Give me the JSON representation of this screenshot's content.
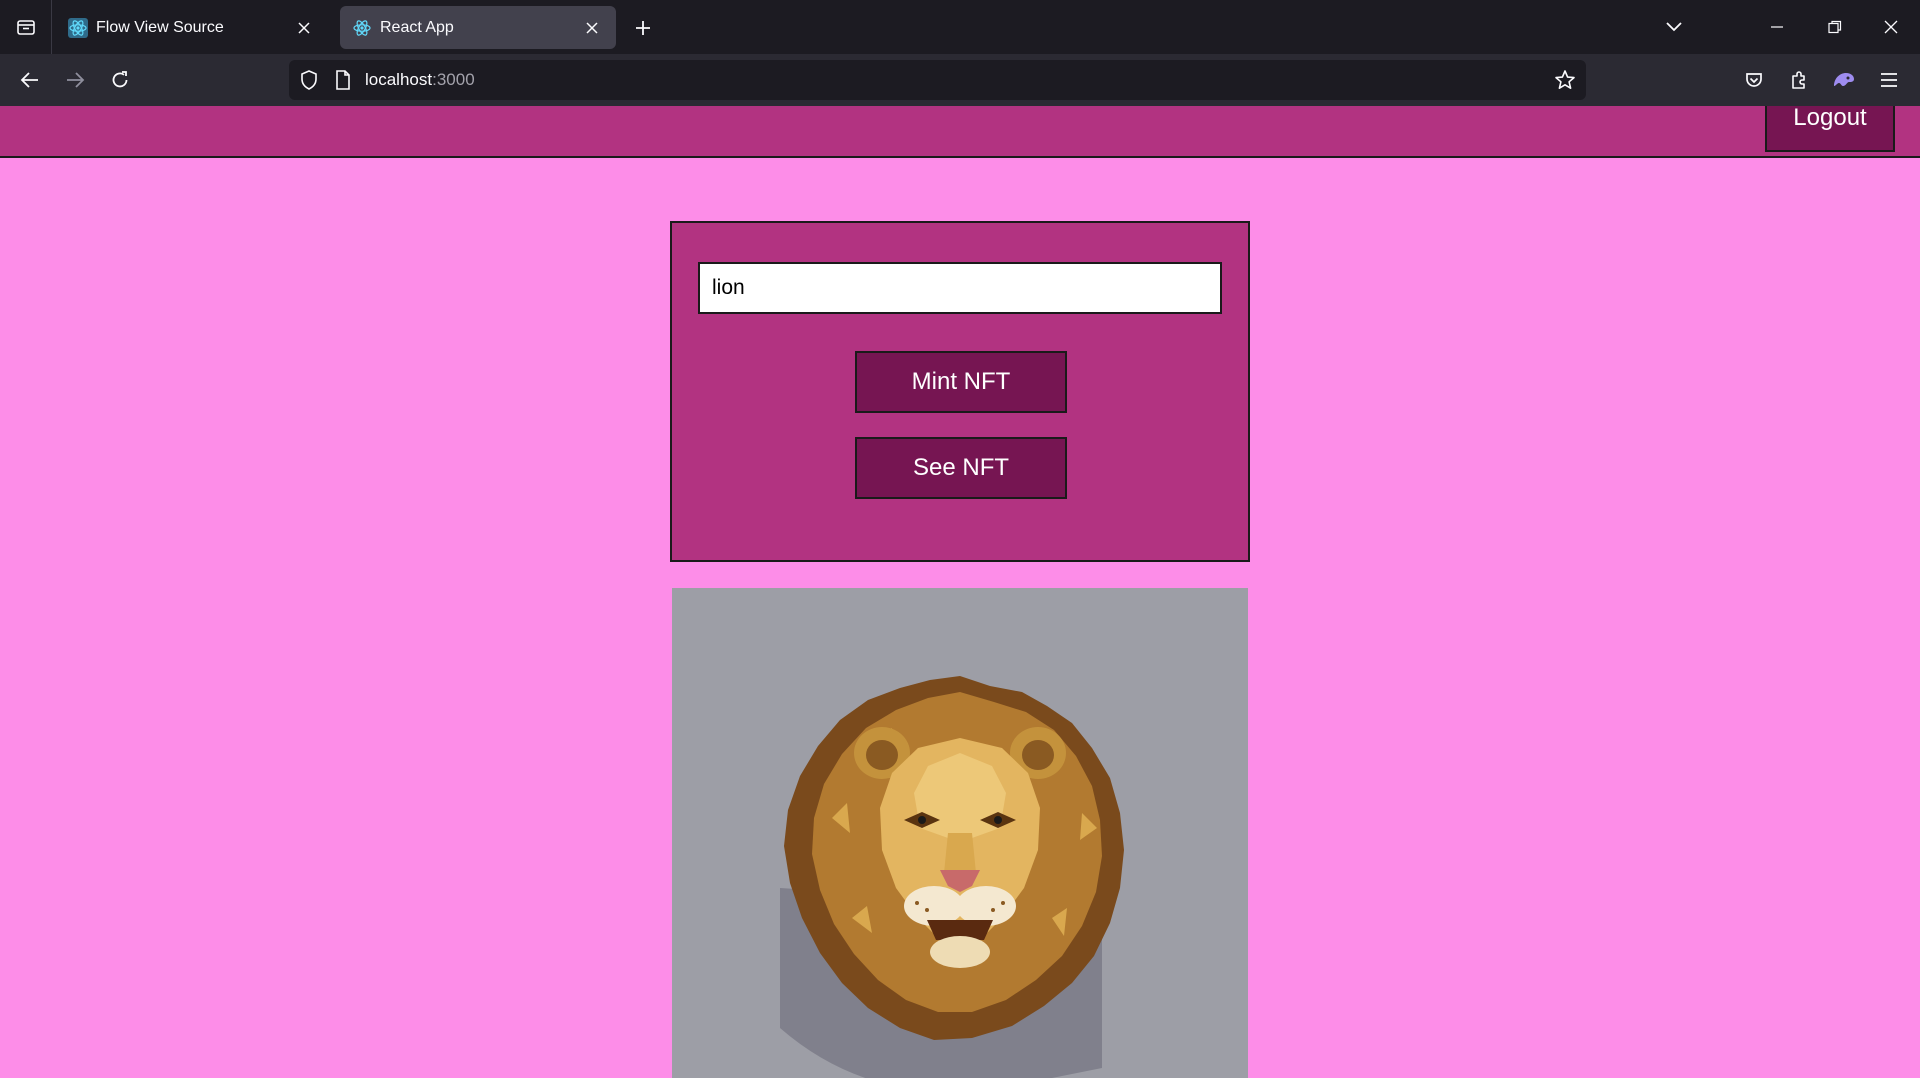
{
  "browser": {
    "tabs": [
      {
        "title": "Flow View Source",
        "active": false,
        "icon": "react-icon"
      },
      {
        "title": "React App",
        "active": true,
        "icon": "react-icon"
      }
    ],
    "url": {
      "host": "localhost",
      "port": ":3000"
    },
    "colors": {
      "tabbar": "#1c1b22",
      "toolbar": "#2b2a33",
      "active_tab": "#42414d"
    }
  },
  "header": {
    "logout_label": "Logout"
  },
  "mint_panel": {
    "input_value": "lion",
    "mint_label": "Mint NFT",
    "see_label": "See NFT"
  },
  "nft": {
    "subject": "pixel-art lion head"
  },
  "colors": {
    "page_bg": "#fd8de8",
    "panel_bg": "#b23381",
    "button_bg": "#761552",
    "image_bg": "#9d9ea6"
  }
}
